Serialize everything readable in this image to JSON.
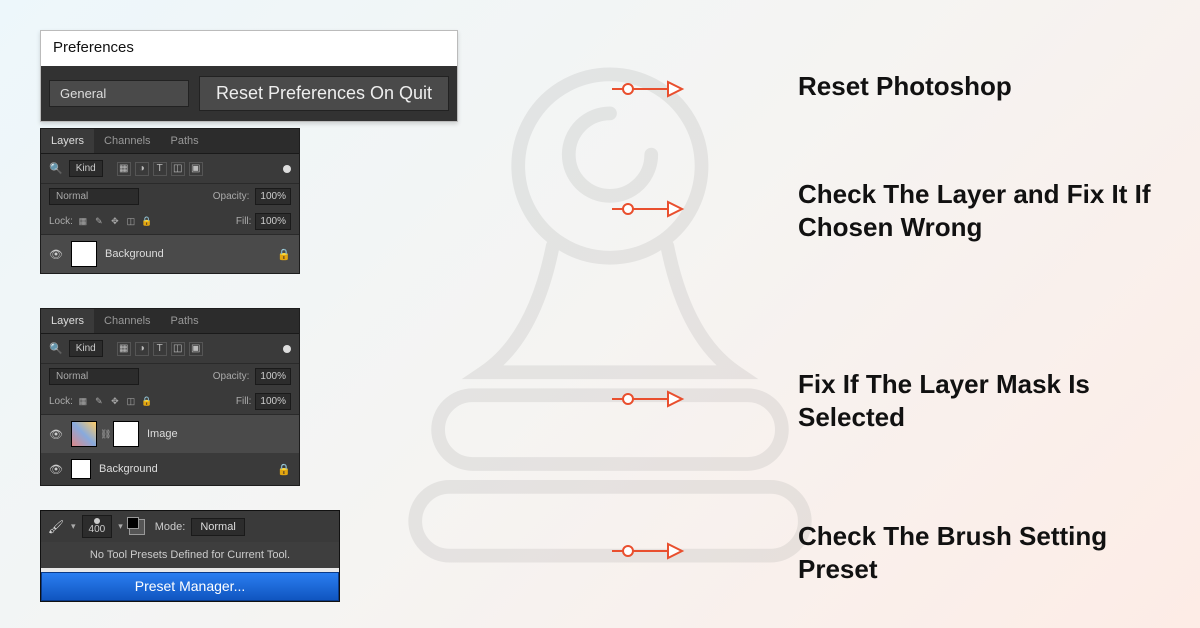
{
  "captions": {
    "row1": "Reset Photoshop",
    "row2": "Check The Layer and Fix It If Chosen Wrong",
    "row3": "Fix If The Layer Mask Is Selected",
    "row4": "Check The Brush Setting Preset"
  },
  "preferences": {
    "title": "Preferences",
    "dropdown": "General",
    "button": "Reset Preferences On Quit"
  },
  "layers_panel": {
    "tabs": {
      "layers": "Layers",
      "channels": "Channels",
      "paths": "Paths"
    },
    "filter_label": "Kind",
    "blend_mode": "Normal",
    "opacity_label": "Opacity:",
    "opacity_value": "100%",
    "lock_label": "Lock:",
    "fill_label": "Fill:",
    "fill_value": "100%",
    "background_layer": "Background",
    "image_layer": "Image"
  },
  "brush": {
    "size": "400",
    "mode_label": "Mode:",
    "mode_value": "Normal",
    "no_preset_msg": "No Tool Presets Defined for Current Tool.",
    "preset_manager": "Preset Manager..."
  }
}
